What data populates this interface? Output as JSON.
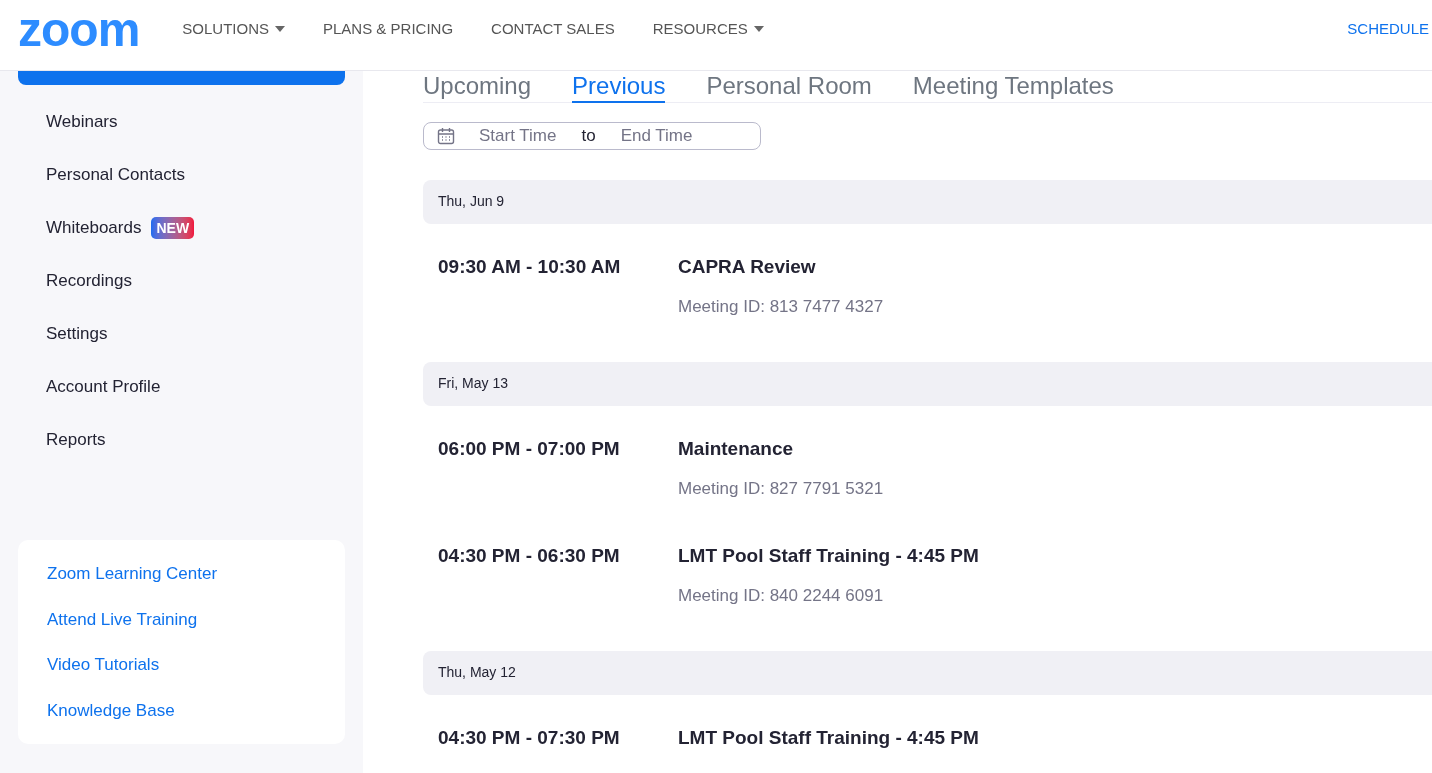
{
  "header": {
    "logo": "zoom",
    "nav": [
      {
        "label": "SOLUTIONS",
        "has_menu": true
      },
      {
        "label": "PLANS & PRICING",
        "has_menu": false
      },
      {
        "label": "CONTACT SALES",
        "has_menu": false
      },
      {
        "label": "RESOURCES",
        "has_menu": true
      }
    ],
    "schedule_link": "SCHEDULE"
  },
  "sidebar": {
    "items": [
      {
        "selected": true
      },
      {
        "label": "Webinars",
        "selected": false
      },
      {
        "label": "Personal Contacts",
        "selected": false
      },
      {
        "label": "Whiteboards",
        "selected": false,
        "badge": "NEW"
      },
      {
        "label": "Recordings",
        "selected": false
      },
      {
        "label": "Settings",
        "selected": false
      },
      {
        "label": "Account Profile",
        "selected": false
      },
      {
        "label": "Reports",
        "selected": false
      }
    ],
    "learning_links": [
      "Zoom Learning Center",
      "Attend Live Training",
      "Video Tutorials",
      "Knowledge Base"
    ]
  },
  "main": {
    "tabs": [
      {
        "label": "Upcoming",
        "selected": false
      },
      {
        "label": "Previous",
        "selected": true
      },
      {
        "label": "Personal Room",
        "selected": false
      },
      {
        "label": "Meeting Templates",
        "selected": false
      }
    ],
    "date_filter": {
      "start_placeholder": "Start Time",
      "separator": "to",
      "end_placeholder": "End Time"
    },
    "groups": [
      {
        "date": "Thu, Jun 9",
        "meetings": [
          {
            "time": "09:30 AM - 10:30 AM",
            "topic": "CAPRA Review",
            "meeting_id": "Meeting ID: 813 7477 4327"
          }
        ]
      },
      {
        "date": "Fri, May 13",
        "meetings": [
          {
            "time": "06:00 PM - 07:00 PM",
            "topic": "Maintenance",
            "meeting_id": "Meeting ID: 827 7791 5321"
          },
          {
            "time": "04:30 PM - 06:30 PM",
            "topic": "LMT Pool Staff Training - 4:45 PM",
            "meeting_id": "Meeting ID: 840 2244 6091"
          }
        ]
      },
      {
        "date": "Thu, May 12",
        "meetings": [
          {
            "time": "04:30 PM - 07:30 PM",
            "topic": "LMT Pool Staff Training - 4:45 PM"
          }
        ]
      }
    ]
  }
}
